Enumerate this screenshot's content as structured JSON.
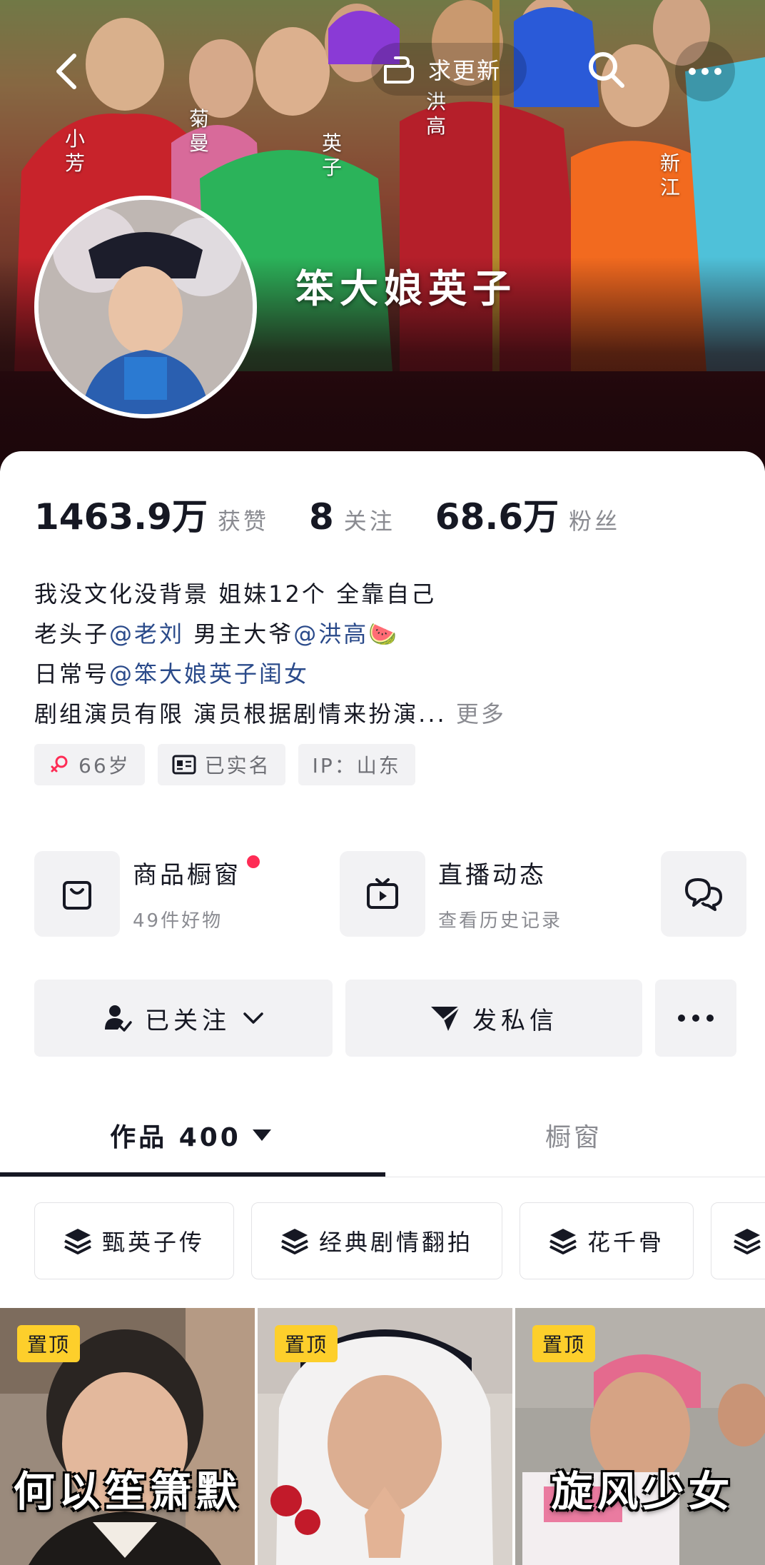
{
  "header": {
    "back_icon": "chevron-left-icon",
    "update_label": "求更新",
    "update_icon": "hand-point-icon",
    "search_icon": "search-icon",
    "more_icon": "ellipsis-icon",
    "cover_labels": [
      "小芳",
      "菊曼",
      "英子",
      "洪高",
      "新江"
    ]
  },
  "profile": {
    "nickname": "笨大娘英子",
    "stats": [
      {
        "value": "1463.9万",
        "label": "获赞"
      },
      {
        "value": "8",
        "label": "关注"
      },
      {
        "value": "68.6万",
        "label": "粉丝"
      }
    ],
    "bio": {
      "line1": "我没文化没背景 姐妹12个 全靠自己",
      "line2_prefix": "老头子",
      "line2_mention1": "@老刘",
      "line2_mid": " 男主大爷",
      "line2_mention2": "@洪高",
      "line2_emoji": "🍉",
      "line3_prefix": "日常号",
      "line3_mention": "@笨大娘英子闺女",
      "line4": "剧组演员有限 演员根据剧情来扮演...",
      "more_label": "更多"
    },
    "tags": [
      {
        "icon": "female-icon",
        "text": "66岁"
      },
      {
        "icon": "id-card-icon",
        "text": "已实名"
      },
      {
        "icon": "",
        "text": "IP：山东"
      }
    ]
  },
  "features": {
    "shop": {
      "title": "商品橱窗",
      "subtitle": "49件好物",
      "icon": "shopping-bag-icon",
      "accent": "#fe2c55"
    },
    "live": {
      "title": "直播动态",
      "subtitle": "查看历史记录",
      "icon": "tv-icon"
    },
    "chat_icon": "group-chat-icon"
  },
  "actions": {
    "follow_label": "已关注",
    "message_label": "发私信",
    "more_icon": "ellipsis-icon"
  },
  "tabs": {
    "works_label": "作品 400",
    "shop_label": "橱窗"
  },
  "collections": [
    {
      "icon": "layers-icon",
      "label": "甄英子传"
    },
    {
      "icon": "layers-icon",
      "label": "经典剧情翻拍"
    },
    {
      "icon": "layers-icon",
      "label": "花千骨"
    }
  ],
  "videos": [
    {
      "pin": "置顶",
      "caption": "何以笙箫默"
    },
    {
      "pin": "置顶",
      "caption": ""
    },
    {
      "pin": "置顶",
      "caption": "旋风少女"
    }
  ],
  "colors": {
    "accent_red": "#fe2c55",
    "mention_blue": "#2a4a8a",
    "pin_yellow": "#fdcf2b"
  }
}
